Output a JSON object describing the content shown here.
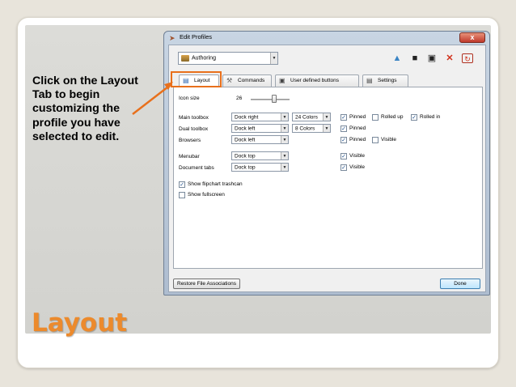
{
  "caption": {
    "lines": [
      "Click on the Layout",
      "Tab to begin",
      "customizing the",
      "profile you have",
      "selected to edit."
    ]
  },
  "slide_title": "Layout",
  "window": {
    "title": "Edit Profiles",
    "close_symbol": "x",
    "profile_select": "Authoring",
    "tabs": [
      {
        "label": "Layout",
        "icon": "layout-icon"
      },
      {
        "label": "Commands",
        "icon": "tools-icon"
      },
      {
        "label": "User defined buttons",
        "icon": "user-button-icon"
      },
      {
        "label": "Settings",
        "icon": "settings-icon"
      }
    ],
    "toolbar_icons": [
      "new-profile-icon",
      "save-icon",
      "save-as-icon",
      "delete-icon",
      "refresh-icon"
    ],
    "layout": {
      "icon_size_label": "Icon size",
      "icon_size_value": "26",
      "rows": [
        {
          "label": "Main toolbox",
          "dock": "Dock right",
          "colors": "24 Colors",
          "checks": [
            {
              "label": "Pinned",
              "checked": true
            },
            {
              "label": "Rolled up",
              "checked": false
            },
            {
              "label": "Rolled in",
              "checked": true
            }
          ]
        },
        {
          "label": "Dual toolbox",
          "dock": "Dock left",
          "colors": "8 Colors",
          "checks": [
            {
              "label": "Pinned",
              "checked": true
            }
          ]
        },
        {
          "label": "Browsers",
          "dock": "Dock left",
          "colors": "",
          "checks": [
            {
              "label": "Pinned",
              "checked": true
            },
            {
              "label": "Visible",
              "checked": false
            }
          ]
        },
        {
          "label": "Menubar",
          "dock": "Dock top",
          "colors": "",
          "checks": [
            {
              "label": "Visible",
              "checked": true
            }
          ]
        },
        {
          "label": "Document tabs",
          "dock": "Dock top",
          "colors": "",
          "checks": [
            {
              "label": "Visible",
              "checked": true
            }
          ]
        }
      ],
      "show_flipchart_trashcan": {
        "label": "Show flipchart trashcan",
        "checked": true
      },
      "show_fullscreen": {
        "label": "Show fullscreen",
        "checked": false
      }
    },
    "restore_button": "Restore File Associations",
    "done_button": "Done"
  },
  "colors": {
    "title_orange": "#ec8a2c",
    "highlight_orange": "#e8701c"
  }
}
